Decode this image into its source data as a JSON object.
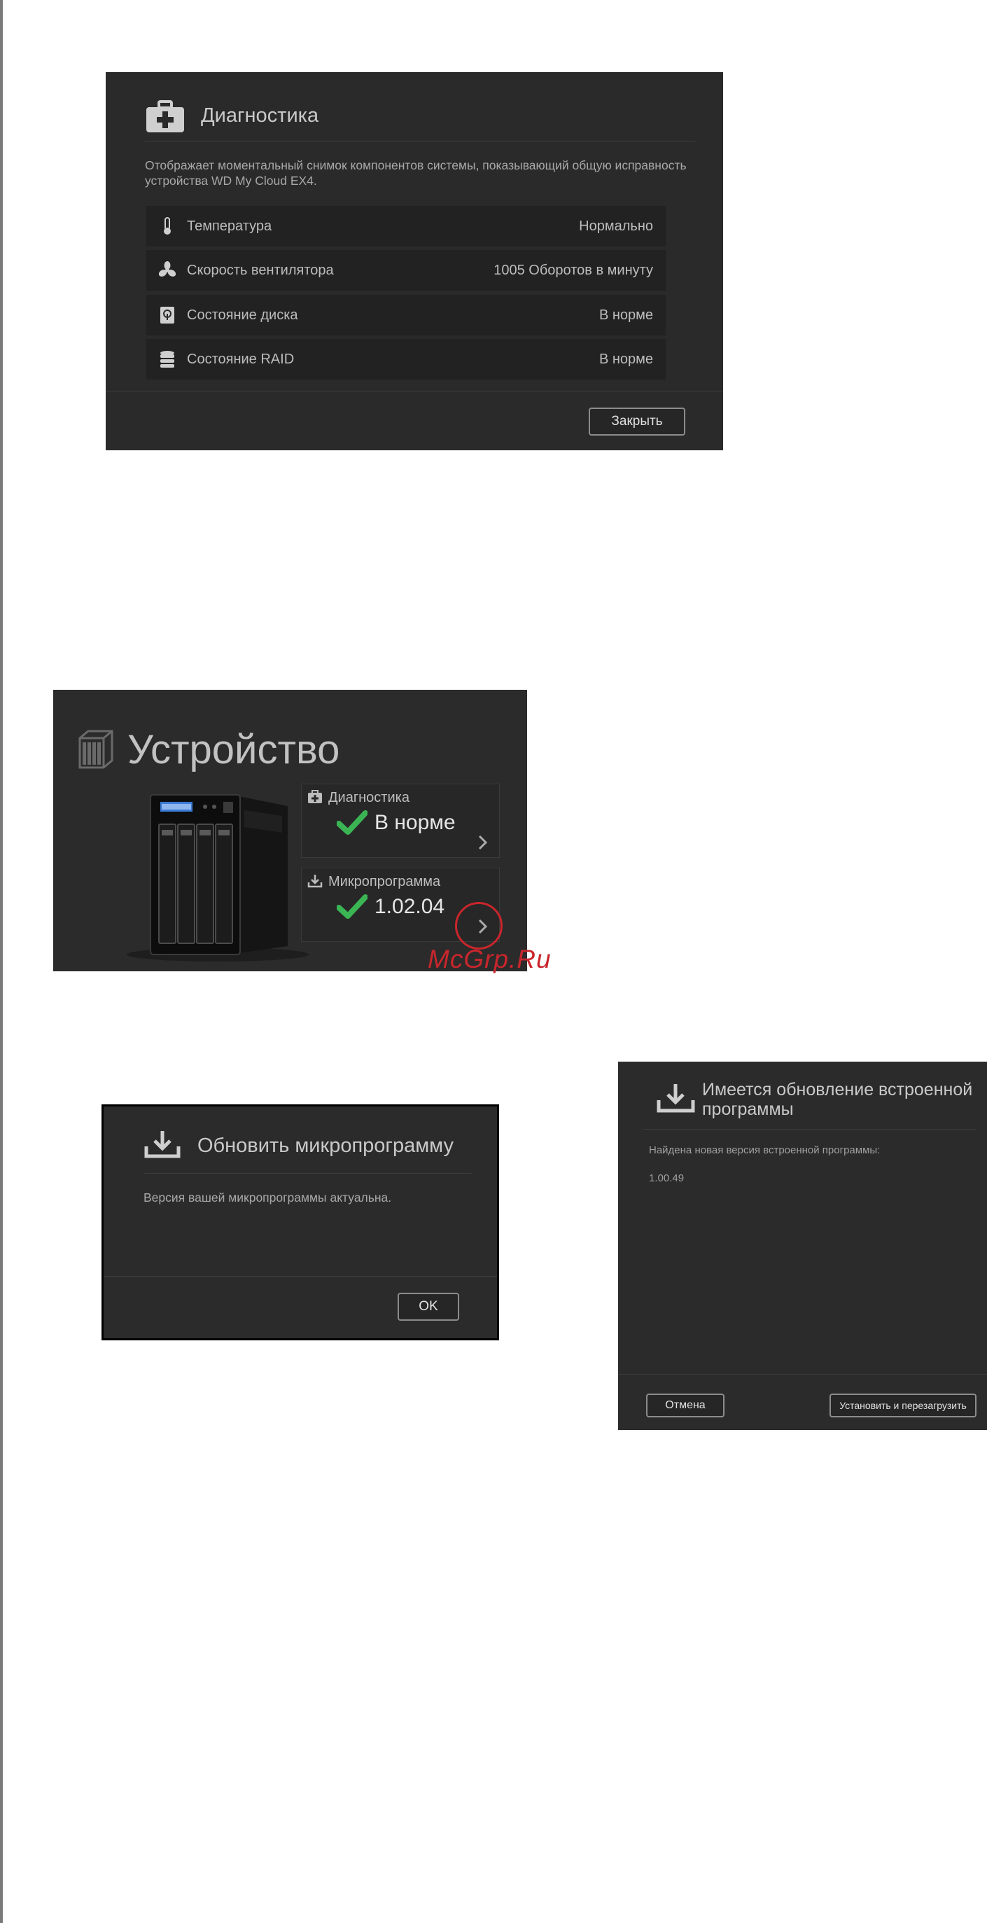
{
  "diagnostics": {
    "title": "Диагностика",
    "description": "Отображает моментальный снимок компонентов системы, показывающий общую исправность устройства WD My Cloud EX4.",
    "rows": [
      {
        "label": "Температура",
        "value": "Нормально",
        "icon": "thermometer-icon"
      },
      {
        "label": "Скорость вентилятора",
        "value": "1005 Оборотов в минуту",
        "icon": "fan-icon"
      },
      {
        "label": "Состояние диска",
        "value": "В норме",
        "icon": "disk-icon"
      },
      {
        "label": "Состояние RAID",
        "value": "В норме",
        "icon": "raid-icon"
      }
    ],
    "close_label": "Закрыть"
  },
  "device": {
    "title": "Устройство",
    "diagnostics_card": {
      "label": "Диагностика",
      "value": "В норме"
    },
    "firmware_card": {
      "label": "Микропрограмма",
      "value": "1.02.04"
    },
    "check_color": "#3bb554",
    "highlight_color": "#c8262c"
  },
  "watermark": "McGrp.Ru",
  "update_firmware": {
    "title": "Обновить микропрограмму",
    "message": "Версия вашей микропрограммы актуальна.",
    "ok_label": "OK"
  },
  "update_available": {
    "title": "Имеется обновление встроенной программы",
    "message": "Найдена новая версия встроенной программы:",
    "version": "1.00.49",
    "cancel_label": "Отмена",
    "install_label": "Установить и перезагрузить"
  }
}
